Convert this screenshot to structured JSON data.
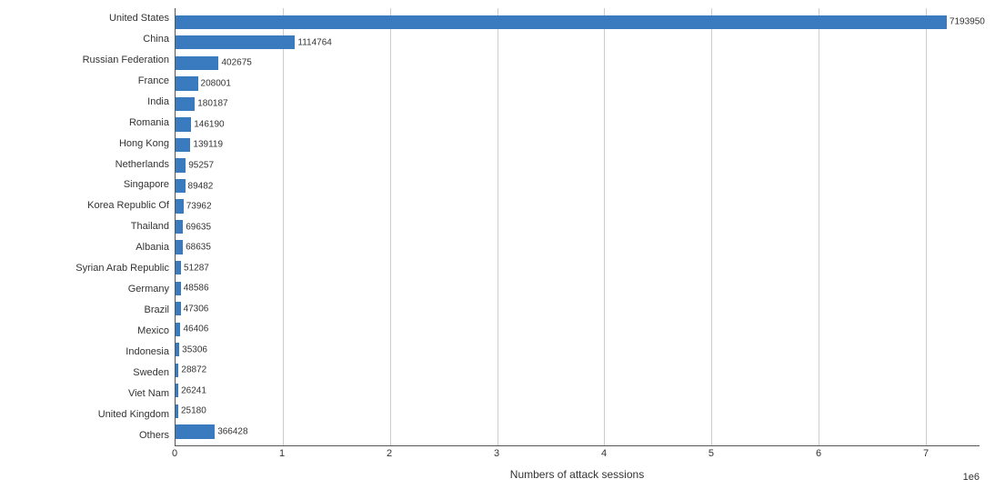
{
  "chart": {
    "title": "Numbers of attack sessions",
    "x_axis_label": "Numbers of attack sessions",
    "x_exp": "1e6",
    "x_ticks": [
      "0",
      "1",
      "2",
      "3",
      "4",
      "5",
      "6",
      "7"
    ],
    "max_value": 7500000,
    "bars": [
      {
        "country": "United States",
        "value": 7193950,
        "label": "7193950"
      },
      {
        "country": "China",
        "value": 1114764,
        "label": "1114764"
      },
      {
        "country": "Russian Federation",
        "value": 402675,
        "label": "402675"
      },
      {
        "country": "France",
        "value": 208001,
        "label": "208001"
      },
      {
        "country": "India",
        "value": 180187,
        "label": "180187"
      },
      {
        "country": "Romania",
        "value": 146190,
        "label": "146190"
      },
      {
        "country": "Hong Kong",
        "value": 139119,
        "label": "139119"
      },
      {
        "country": "Netherlands",
        "value": 95257,
        "label": "95257"
      },
      {
        "country": "Singapore",
        "value": 89482,
        "label": "89482"
      },
      {
        "country": "Korea Republic Of",
        "value": 73962,
        "label": "73962"
      },
      {
        "country": "Thailand",
        "value": 69635,
        "label": "69635"
      },
      {
        "country": "Albania",
        "value": 68635,
        "label": "68635"
      },
      {
        "country": "Syrian Arab Republic",
        "value": 51287,
        "label": "51287"
      },
      {
        "country": "Germany",
        "value": 48586,
        "label": "48586"
      },
      {
        "country": "Brazil",
        "value": 47306,
        "label": "47306"
      },
      {
        "country": "Mexico",
        "value": 46406,
        "label": "46406"
      },
      {
        "country": "Indonesia",
        "value": 35306,
        "label": "35306"
      },
      {
        "country": "Sweden",
        "value": 28872,
        "label": "28872"
      },
      {
        "country": "Viet Nam",
        "value": 26241,
        "label": "26241"
      },
      {
        "country": "United Kingdom",
        "value": 25180,
        "label": "25180"
      },
      {
        "country": "Others",
        "value": 366428,
        "label": "366428"
      }
    ]
  }
}
